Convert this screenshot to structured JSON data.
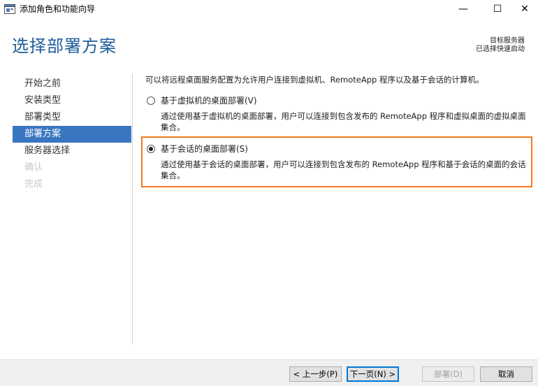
{
  "window": {
    "title": "添加角色和功能向导",
    "minimize_glyph": "—",
    "maximize_glyph": "☐",
    "close_glyph": "✕"
  },
  "header": {
    "title": "选择部署方案",
    "server_label": "目标服务器",
    "server_value": "已选择快速启动"
  },
  "nav": {
    "items": [
      {
        "label": "开始之前",
        "state": "normal"
      },
      {
        "label": "安装类型",
        "state": "normal"
      },
      {
        "label": "部署类型",
        "state": "normal"
      },
      {
        "label": "部署方案",
        "state": "active"
      },
      {
        "label": "服务器选择",
        "state": "normal"
      },
      {
        "label": "确认",
        "state": "disabled"
      },
      {
        "label": "完成",
        "state": "disabled"
      }
    ]
  },
  "content": {
    "intro": "可以将远程桌面服务配置为允许用户连接到虚拟机、RemoteApp 程序以及基于会话的计算机。",
    "options": [
      {
        "label": "基于虚拟机的桌面部署(V)",
        "description": "通过使用基于虚拟机的桌面部署，用户可以连接到包含发布的 RemoteApp 程序和虚拟桌面的虚拟桌面集合。",
        "selected": false
      },
      {
        "label": "基于会话的桌面部署(S)",
        "description": "通过使用基于会话的桌面部署，用户可以连接到包含发布的 RemoteApp 程序和基于会话的桌面的会话集合。",
        "selected": true
      }
    ]
  },
  "footer": {
    "prev_label": "< 上一步(P)",
    "next_label": "下一页(N) >",
    "deploy_label": "部署(D)",
    "cancel_label": "取消"
  },
  "colors": {
    "accent": "#1e5c9b",
    "nav_active": "#3a76c0",
    "highlight": "#f07a1c"
  }
}
